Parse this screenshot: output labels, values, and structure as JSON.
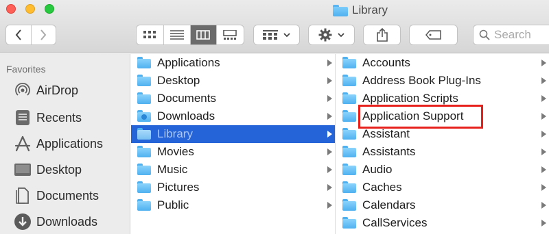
{
  "window": {
    "title": "Library"
  },
  "toolbar": {
    "search_placeholder": "Search"
  },
  "sidebar": {
    "heading": "Favorites",
    "items": [
      {
        "label": "AirDrop",
        "icon": "airdrop-icon"
      },
      {
        "label": "Recents",
        "icon": "recents-icon"
      },
      {
        "label": "Applications",
        "icon": "applications-icon"
      },
      {
        "label": "Desktop",
        "icon": "desktop-icon"
      },
      {
        "label": "Documents",
        "icon": "documents-icon"
      },
      {
        "label": "Downloads",
        "icon": "downloads-icon"
      }
    ]
  },
  "column1": {
    "items": [
      {
        "label": "Applications"
      },
      {
        "label": "Desktop"
      },
      {
        "label": "Documents"
      },
      {
        "label": "Downloads"
      },
      {
        "label": "Library",
        "selected": true
      },
      {
        "label": "Movies"
      },
      {
        "label": "Music"
      },
      {
        "label": "Pictures"
      },
      {
        "label": "Public"
      }
    ]
  },
  "column2": {
    "items": [
      {
        "label": "Accounts"
      },
      {
        "label": "Address Book Plug-Ins"
      },
      {
        "label": "Application Scripts"
      },
      {
        "label": "Application Support",
        "highlighted": true
      },
      {
        "label": "Assistant"
      },
      {
        "label": "Assistants"
      },
      {
        "label": "Audio"
      },
      {
        "label": "Caches"
      },
      {
        "label": "Calendars"
      },
      {
        "label": "CallServices"
      }
    ]
  },
  "colors": {
    "selection": "#2563d8",
    "highlight_box": "#e8201c"
  }
}
